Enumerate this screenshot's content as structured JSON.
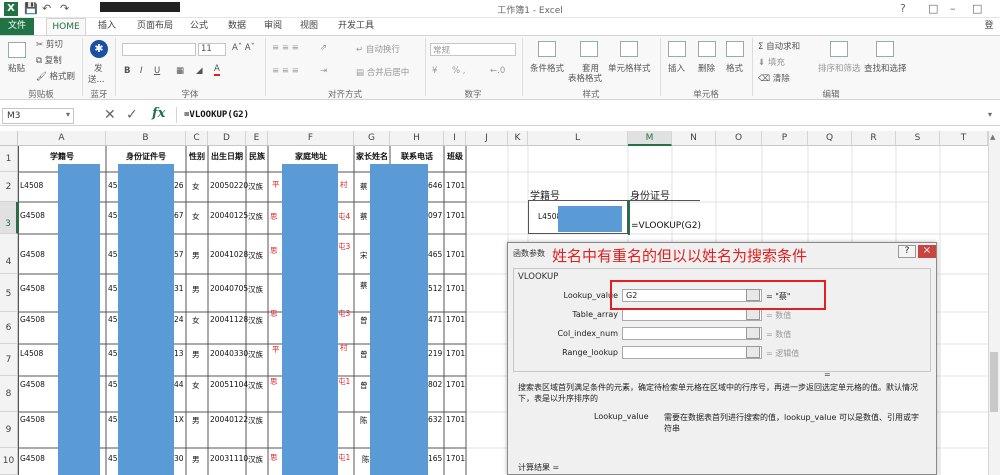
{
  "app": {
    "logo": "X",
    "title": "工作簿1 - Excel",
    "user": "登"
  },
  "tabs": [
    "文件",
    "HOME",
    "插入",
    "页面布局",
    "公式",
    "数据",
    "审阅",
    "视图",
    "开发工具"
  ],
  "ribbon": {
    "clipboard": {
      "paste": "粘贴",
      "cut": "剪切",
      "copy": "复制",
      "format_painter": "格式刷",
      "label": "剪贴板"
    },
    "bluetooth": {
      "send": "发",
      "send2": "送...",
      "label": "蓝牙"
    },
    "font": {
      "size": "11",
      "bold": "B",
      "italic": "I",
      "underline": "U",
      "font_a": "A",
      "label": "字体"
    },
    "align": {
      "wrap": "自动换行",
      "merge": "合并后居中",
      "label": "对齐方式"
    },
    "number": {
      "format": "常规",
      "percent": "% ,",
      "label": "数字"
    },
    "styles": {
      "cond": "条件格式",
      "table": "套用",
      "table2": "表格格式",
      "cell_style": "单元格样式",
      "label": "样式"
    },
    "cells": {
      "insert": "插入",
      "delete": "删除",
      "format": "格式",
      "label": "单元格"
    },
    "editing": {
      "autosum": "自动求和",
      "fill": "填充",
      "clear": "清除",
      "sort": "排序和筛选",
      "find": "查找和选择",
      "label": "编辑"
    }
  },
  "formula_bar": {
    "namebox": "M3",
    "fx": "fx",
    "formula": "=VLOOKUP(G2)"
  },
  "columns": [
    "A",
    "B",
    "C",
    "D",
    "E",
    "F",
    "G",
    "H",
    "I",
    "J",
    "K",
    "L",
    "M",
    "N",
    "O",
    "P",
    "Q",
    "R",
    "S",
    "T"
  ],
  "rows": [
    "1",
    "2",
    "3",
    "4",
    "5",
    "6",
    "7",
    "8",
    "9",
    "10"
  ],
  "headers": {
    "a": "学籍号",
    "b": "身份证件号",
    "c": "性别",
    "d": "出生日期",
    "e": "民族",
    "f": "家庭地址",
    "g": "家长姓名",
    "h": "联系电话",
    "i": "班级"
  },
  "data_rows": [
    {
      "a": "L4508",
      "b": "45",
      "b2": "26",
      "c": "女",
      "d": "20050220",
      "e": "汉族",
      "f": "平",
      "f2": "村",
      "g": "蔡",
      "h": "646",
      "i": "1701"
    },
    {
      "a": "G4508",
      "b": "45",
      "b2": "67",
      "c": "女",
      "d": "20040125",
      "e": "汉族",
      "f": "思",
      "f2": "屯4",
      "g": "蔡",
      "h": "097",
      "i": "1701"
    },
    {
      "a": "G4508",
      "b": "45",
      "b2": "57",
      "c": "男",
      "d": "20041028",
      "e": "汉族",
      "f": "思",
      "f2": "屯3",
      "g": "宋",
      "h": "465",
      "i": "1701"
    },
    {
      "a": "G4508",
      "b": "45",
      "b2": "31",
      "c": "男",
      "d": "20040705",
      "e": "汉族",
      "f": "",
      "f2": "",
      "g": "蔡",
      "h": "512",
      "i": "1701"
    },
    {
      "a": "G4508",
      "b": "45",
      "b2": "24",
      "c": "女",
      "d": "20041128",
      "e": "汉族",
      "f": "思",
      "f2": "屯3",
      "g": "曾",
      "h": "471",
      "i": "1701"
    },
    {
      "a": "L4508",
      "b": "45",
      "b2": "13",
      "c": "男",
      "d": "20040330",
      "e": "汉族",
      "f": "平",
      "f2": "村",
      "g": "曾",
      "h": "219",
      "i": "1701"
    },
    {
      "a": "G4508",
      "b": "45",
      "b2": "44",
      "c": "女",
      "d": "20051104",
      "e": "汉族",
      "f": "思",
      "f2": "屯1",
      "g": "曾",
      "h": "802",
      "i": "1701"
    },
    {
      "a": "G4508",
      "b": "45",
      "b2": "1X",
      "c": "男",
      "d": "20040122",
      "e": "汉族",
      "f": "",
      "f2": "",
      "g": "陈",
      "h": "632",
      "i": "1701"
    },
    {
      "a": "G4508",
      "b": "45",
      "b2": "30",
      "c": "男",
      "d": "20031110",
      "e": "汉族",
      "f": "思",
      "f2": "屯1",
      "g": "陈",
      "h": "165",
      "i": "1701"
    }
  ],
  "lookup_panel": {
    "h1": "学籍号",
    "h2": "身份证号",
    "id": "L4508",
    "formula": "=VLOOKUP(G2)"
  },
  "dialog": {
    "title": "函数参数",
    "annotation": "姓名中有重名的但以以姓名为搜索条件",
    "func": "VLOOKUP",
    "args": [
      {
        "label": "Lookup_value",
        "value": "G2",
        "result": "= \"蔡\""
      },
      {
        "label": "Table_array",
        "value": "",
        "result": "= 数值"
      },
      {
        "label": "Col_index_num",
        "value": "",
        "result": "= 数值"
      },
      {
        "label": "Range_lookup",
        "value": "",
        "result": "= 逻辑值"
      }
    ],
    "eq": "=",
    "desc": "搜索表区域首列满足条件的元素，确定待检索单元格在区域中的行序号，再进一步返回选定单元格的值。默认情况下，表是以升序排序的",
    "arg_help_name": "Lookup_value",
    "arg_help": "需要在数据表首列进行搜索的值，lookup_value 可以是数值、引用或字符串",
    "result": "计算结果 =",
    "help_btn": "?",
    "close_btn": "×"
  },
  "colors": {
    "accent": "#217346",
    "mask": "#5b9bd5",
    "annotation": "#e02020"
  }
}
